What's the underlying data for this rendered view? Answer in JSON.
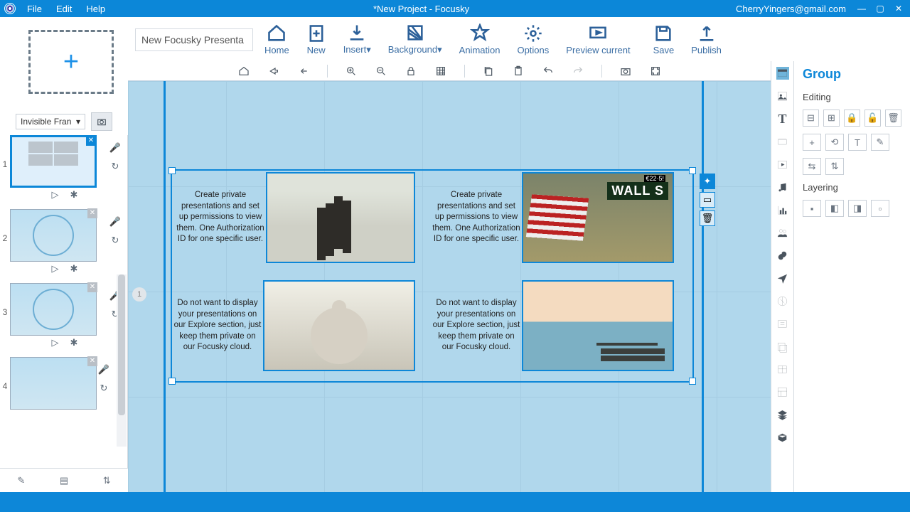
{
  "titlebar": {
    "menus": {
      "file": "File",
      "edit": "Edit",
      "help": "Help"
    },
    "title": "*New Project - Focusky",
    "user": "CherryYingers@gmail.com"
  },
  "project_name_field": "New Focusky Presenta",
  "frame_dropdown": "Invisible Fran",
  "toolbar": {
    "home": "Home",
    "new": "New",
    "insert": "Insert",
    "background": "Background",
    "animation": "Animation",
    "options": "Options",
    "preview": "Preview current",
    "save": "Save",
    "publish": "Publish"
  },
  "slides": {
    "labels": [
      "1",
      "2",
      "3",
      "4"
    ]
  },
  "canvas": {
    "text_a": "Create private presentations and set up permissions to view them. One Authorization ID for one specific user.",
    "text_b": "Create private presentations and set up permissions to view them. One Authorization ID for one specific user.",
    "text_c": "Do not want to display your presentations on our Explore section, just keep them private on our Focusky cloud.",
    "text_d": "Do not want to display your presentations on our Explore section, just keep them private on our Focusky cloud.",
    "wall_sign": "WALL S",
    "wall_clock": "€22·5!"
  },
  "props": {
    "title": "Group",
    "editing_label": "Editing",
    "layering_label": "Layering"
  },
  "icons": {
    "plus": "+",
    "tri": "▾",
    "dot": "●",
    "gear": "✱",
    "mic": "🎤",
    "clock": "↻",
    "play": "▷",
    "lock": "🔒",
    "unlock": "🔓",
    "trash": "🗑",
    "t": "T",
    "brush": "✎"
  }
}
